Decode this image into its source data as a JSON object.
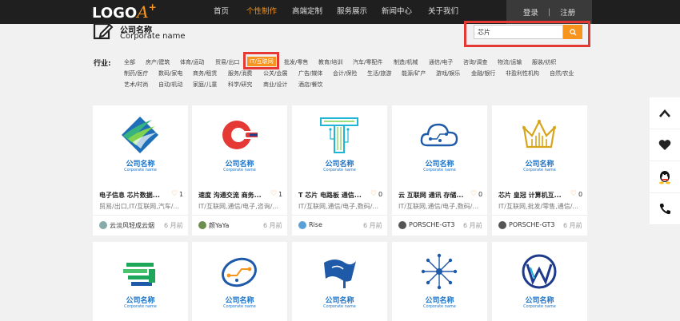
{
  "logo": {
    "text": "LOGO",
    "accent": "A",
    "plus": "+"
  },
  "nav": {
    "items": [
      "首页",
      "个性制作",
      "高端定制",
      "服务展示",
      "新闻中心",
      "关于我们"
    ],
    "active_index": 1
  },
  "auth": {
    "login": "登录",
    "sep": "|",
    "register": "注册"
  },
  "company": {
    "name": "公司名称",
    "sub": "Corporate name"
  },
  "search": {
    "value": "芯片"
  },
  "filter": {
    "label": "行业:",
    "rows": [
      [
        "全部",
        "房产/建筑",
        "体育/运动",
        "贸易/出口",
        "IT/互联网",
        "批发/零售",
        "教育/培训",
        "汽车/零配件",
        "制造/机械",
        "通信/电子",
        "咨询/调查",
        "物流/运输",
        "服装/纺织"
      ],
      [
        "制药/医疗",
        "数码/家电",
        "商务/租赁",
        "服务/消费",
        "公关/会展",
        "广告/媒体",
        "会计/保险",
        "生活/旅游",
        "能源/矿产",
        "游戏/娱乐",
        "金融/银行",
        "非盈利性机构",
        "自然/农业"
      ],
      [
        "艺术/时尚",
        "自动/机动",
        "家庭/儿童",
        "科学/研究",
        "商业/设计",
        "酒店/餐饮"
      ]
    ],
    "active": "IT/互联网"
  },
  "cards": [
    {
      "name": "公司名称",
      "sub": "Corporate name",
      "title": "电子信息 芯片数据...",
      "likes": "1",
      "tags": "贸易/出口,IT/互联网,汽车/...",
      "author": "云淡风轻成云烟",
      "time": "6 月前",
      "icon": "diamond-wing-icon",
      "color": "#2a9d5c"
    },
    {
      "name": "公司名称",
      "sub": "Corporate name",
      "title": "速度 沟通交流 商务...",
      "likes": "1",
      "tags": "IT/互联网,通信/电子,咨询/...",
      "author": "颜YaYa",
      "time": "6 月前",
      "icon": "speed-c-icon",
      "color": "#e53935"
    },
    {
      "name": "公司名称",
      "sub": "Corporate name",
      "title": "T 芯片 电路板 通信...",
      "likes": "0",
      "tags": "IT/互联网,通信/电子,数码/...",
      "author": "Rise",
      "time": "6 月前",
      "icon": "circuit-t-icon",
      "color": "#1fb5d6"
    },
    {
      "name": "公司名称",
      "sub": "Corporate name",
      "title": "云 互联网 通讯 存储...",
      "likes": "0",
      "tags": "IT/互联网,通信/电子,数码/...",
      "author": "PORSCHE-GT3",
      "time": "6 月前",
      "icon": "cloud-circuit-icon",
      "color": "#1e5aa8"
    },
    {
      "name": "公司名称",
      "sub": "Corporate name",
      "title": "芯片 皇冠 计算机互...",
      "likes": "0",
      "tags": "IT/互联网,批发/零售,通信/...",
      "author": "PORSCHE-GT3",
      "time": "6 月前",
      "icon": "crown-chip-icon",
      "color": "#d6a51a"
    },
    {
      "name": "公司名称",
      "sub": "Corporate name",
      "icon": "speed-g-icon",
      "color": "#1ea65a"
    },
    {
      "name": "公司名称",
      "sub": "Corporate name",
      "icon": "circuit-oval-icon",
      "color": "#1e5aa8"
    },
    {
      "name": "公司名称",
      "sub": "Corporate name",
      "icon": "flag-icon",
      "color": "#1e5aa8"
    },
    {
      "name": "公司名称",
      "sub": "Corporate name",
      "icon": "network-burst-icon",
      "color": "#1e5aa8"
    },
    {
      "name": "公司名称",
      "sub": "Corporate name",
      "icon": "globe-w-icon",
      "color": "#1e3a8a"
    }
  ],
  "sidebar": {
    "icons": [
      "chevron-up-icon",
      "heart-icon",
      "qq-icon",
      "phone-icon"
    ]
  }
}
